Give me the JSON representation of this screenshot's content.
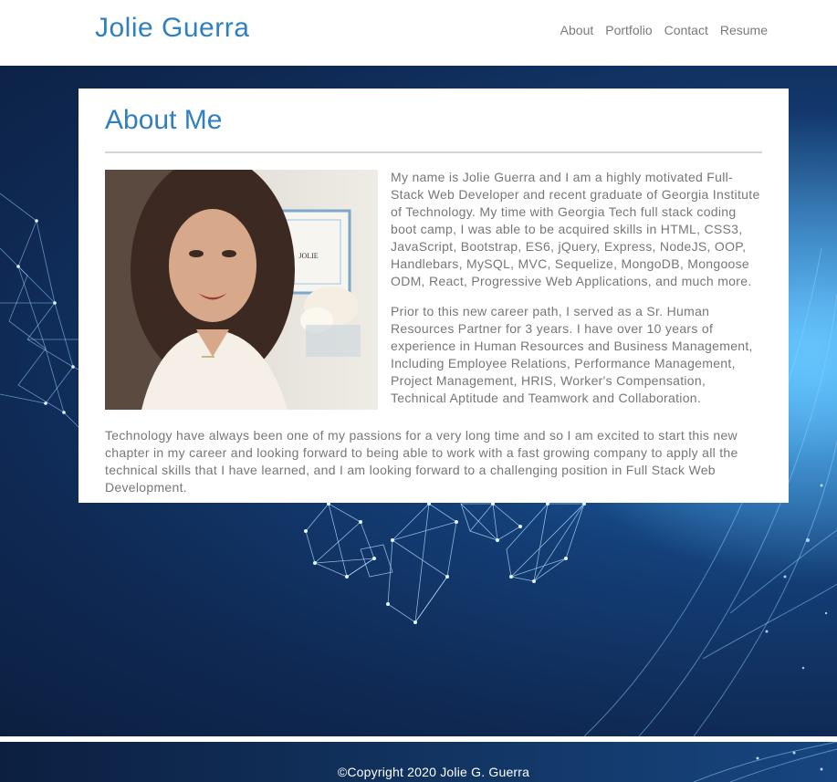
{
  "header": {
    "brand": "Jolie Guerra",
    "nav": [
      "About",
      "Portfolio",
      "Contact",
      "Resume"
    ]
  },
  "about": {
    "title": "About Me",
    "paragraphs": [
      "My name is Jolie Guerra and I am a highly motivated Full-Stack Web Developer and recent graduate of Georgia Institute of Technology. My time with Georgia Tech full stack coding boot camp, I was able to be acquired skills in HTML, CSS3, JavaScript, Bootstrap, ES6, jQuery, Express, NodeJS, OOP, Handlebars, MySQL, MVC, Sequelize, MongoDB, Mongoose ODM, React, Progressive Web Applications, and much more.",
      "Prior to this new career path, I served as a Sr. Human Resources Partner for 3 years. I have over 10 years of experience in Human Resources and Business Management, Including Employee Relations, Performance Management, Project Management, HRIS, Worker's Compensation, Technical Aptitude and Teamwork and Collaboration.",
      "Technology have always been one of my passions for a very long time and so I am excited to start this new chapter in my career and looking forward to being able to work with a fast growing company to apply all the technical skills that I have learned, and I am looking forward to a challenging position in Full Stack Web Development."
    ],
    "photo_sign": "JOLIE"
  },
  "footer": {
    "copyright": "©Copyright 2020 Jolie G. Guerra"
  },
  "colors": {
    "accent": "#2f7fc1",
    "body_text": "#777777",
    "hero_dark": "#0f2a55",
    "hero_glow": "#3aa6ee"
  }
}
